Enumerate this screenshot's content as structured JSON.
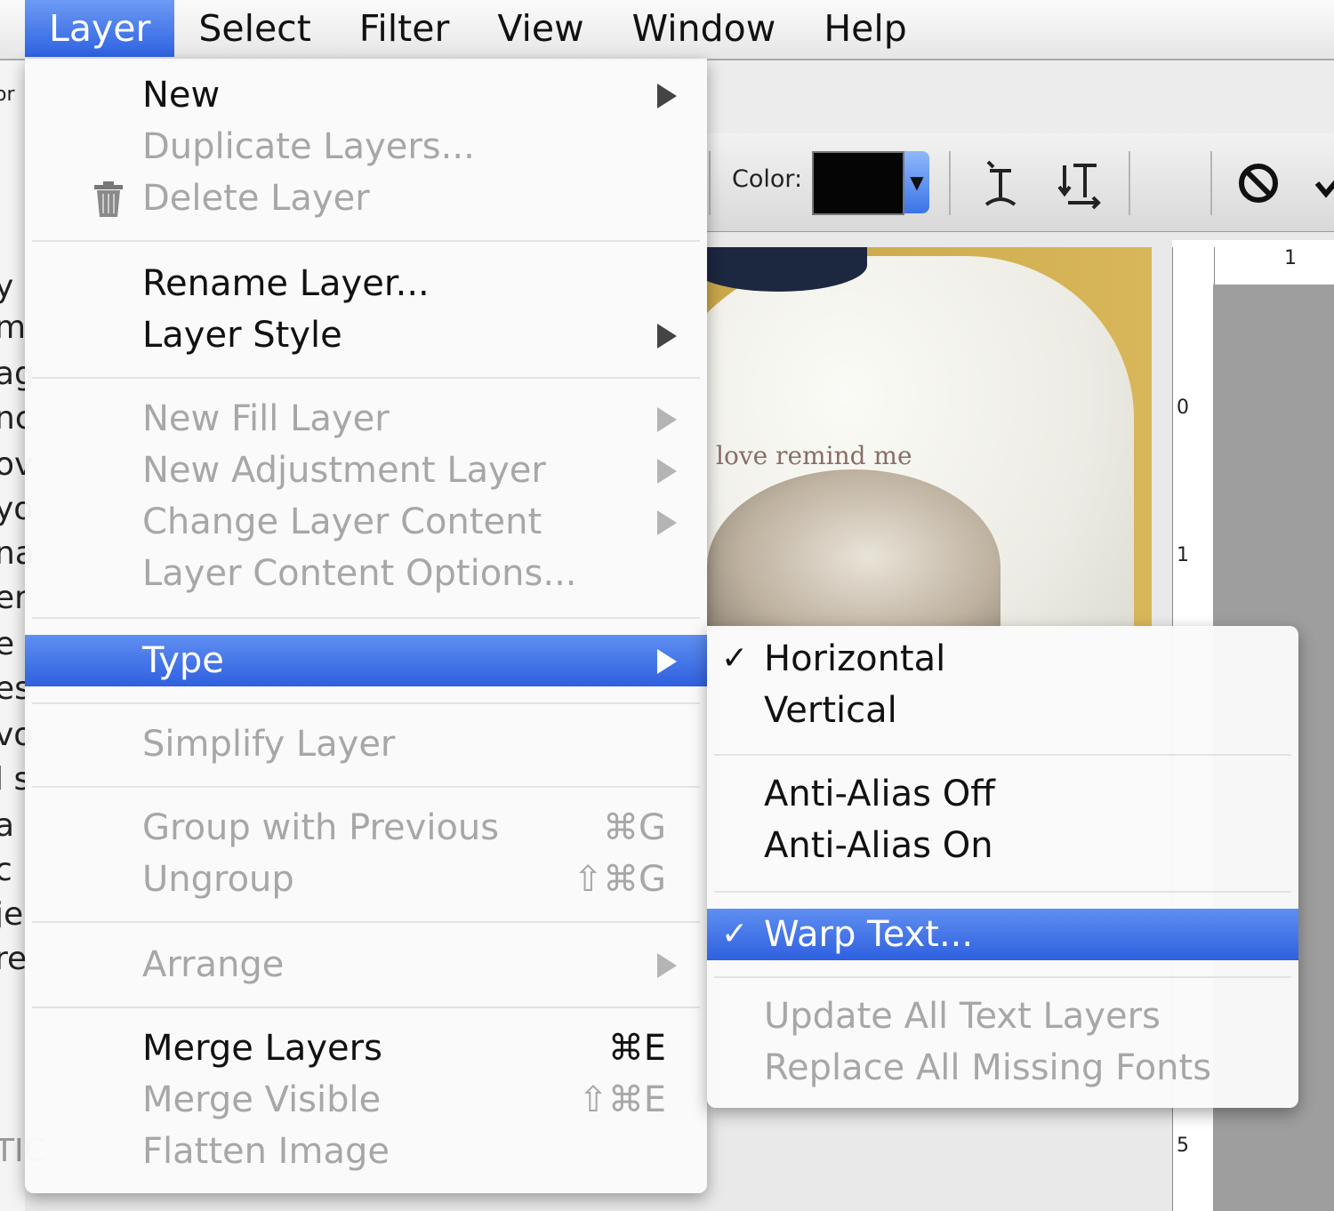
{
  "menubar": {
    "items": [
      "Layer",
      "Select",
      "Filter",
      "View",
      "Window",
      "Help"
    ]
  },
  "options_bar": {
    "color_label": "Color:"
  },
  "background": {
    "left_fragments": [
      "or",
      "y",
      "m",
      "ag",
      "nc",
      "ov",
      "yo",
      "na",
      "er",
      "e",
      "es",
      "vo",
      "l s",
      "a",
      "c",
      "je",
      "re",
      "TIC"
    ],
    "photo_text": "love remind me",
    "ruler_labels": [
      "1",
      "0",
      "1",
      "5"
    ]
  },
  "layer_menu": {
    "new": "New",
    "duplicate": "Duplicate Layers...",
    "delete": "Delete Layer",
    "rename": "Rename Layer...",
    "layer_style": "Layer Style",
    "new_fill": "New Fill Layer",
    "new_adjustment": "New Adjustment Layer",
    "change_content": "Change Layer Content",
    "content_options": "Layer Content Options...",
    "type": "Type",
    "simplify": "Simplify Layer",
    "group_with_previous": "Group with Previous",
    "group_shortcut": "⌘G",
    "ungroup": "Ungroup",
    "ungroup_shortcut": "⇧⌘G",
    "arrange": "Arrange",
    "merge_layers": "Merge Layers",
    "merge_shortcut": "⌘E",
    "merge_visible": "Merge Visible",
    "merge_visible_shortcut": "⇧⌘E",
    "flatten": "Flatten Image"
  },
  "type_submenu": {
    "horizontal": "Horizontal",
    "vertical": "Vertical",
    "aa_off": "Anti-Alias Off",
    "aa_on": "Anti-Alias On",
    "warp": "Warp Text...",
    "update_all": "Update All Text Layers",
    "replace_fonts": "Replace All Missing Fonts",
    "checkmark": "✓"
  },
  "colors": {
    "selection": "#2f60df",
    "disabled_text": "#a7a7a7"
  }
}
